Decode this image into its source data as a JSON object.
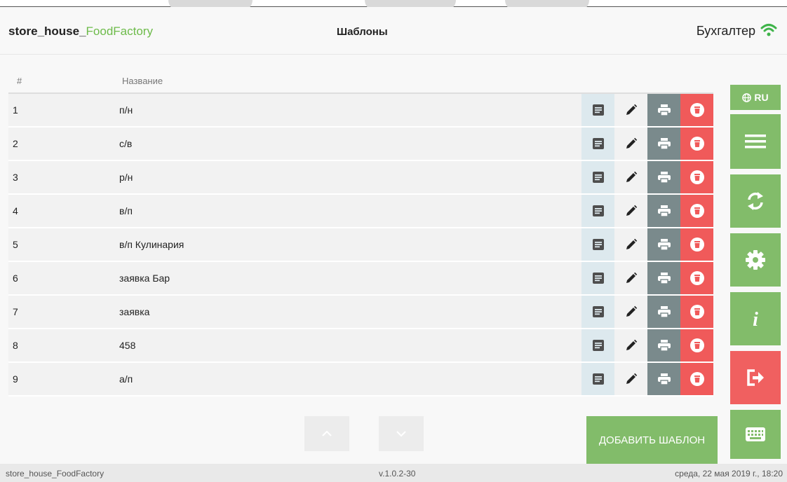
{
  "header": {
    "brand_part1": "store_house_",
    "brand_part2": "FoodFactory",
    "title": "Шаблоны",
    "user": "Бухгалтер"
  },
  "table": {
    "columns": [
      "#",
      "Название"
    ],
    "rows": [
      {
        "num": "1",
        "name": "п/н"
      },
      {
        "num": "2",
        "name": "с/в"
      },
      {
        "num": "3",
        "name": "р/н"
      },
      {
        "num": "4",
        "name": "в/п"
      },
      {
        "num": "5",
        "name": "в/п Кулинария"
      },
      {
        "num": "6",
        "name": "заявка Бар"
      },
      {
        "num": "7",
        "name": "заявка"
      },
      {
        "num": "8",
        "name": "458"
      },
      {
        "num": "9",
        "name": "а/п"
      }
    ]
  },
  "sidebar": {
    "language": "RU"
  },
  "actions": {
    "add_template": "ДОБАВИТЬ ШАБЛОН"
  },
  "footer": {
    "app_name": "store_house_FoodFactory",
    "version": "v.1.0.2-30",
    "datetime": "среда, 22 мая 2019 г., 18:20"
  },
  "colors": {
    "accent_green": "#82bc6a",
    "danger_red": "#f06060",
    "print_gray": "#7a8a8c",
    "view_blue": "#dde9ee"
  },
  "icons": {
    "row_actions": [
      "document-icon",
      "pencil-icon",
      "printer-icon",
      "trash-icon"
    ],
    "sidebar": [
      "globe-icon",
      "menu-icon",
      "sync-icon",
      "gear-icon",
      "info-icon",
      "logout-icon",
      "keyboard-icon"
    ]
  }
}
